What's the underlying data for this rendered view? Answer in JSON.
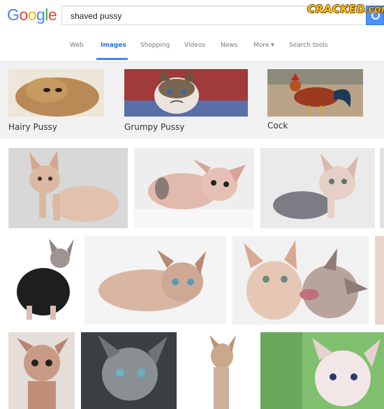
{
  "search": {
    "query": "shaved pussy"
  },
  "logo": {
    "letters": [
      "G",
      "o",
      "o",
      "g",
      "l",
      "e"
    ],
    "colors": [
      "#4285f4",
      "#ea4335",
      "#fbbc05",
      "#4285f4",
      "#34a853",
      "#ea4335"
    ]
  },
  "watermark": {
    "text": "CRACKED",
    "suffix": ".COM"
  },
  "nav": {
    "tabs": [
      {
        "label": "Web"
      },
      {
        "label": "Images"
      },
      {
        "label": "Shopping"
      },
      {
        "label": "Videos"
      },
      {
        "label": "News"
      },
      {
        "label": "More ▾"
      },
      {
        "label": "Search tools"
      }
    ],
    "active": "Images"
  },
  "related": [
    {
      "label": "Hairy Pussy"
    },
    {
      "label": "Grumpy Pussy"
    },
    {
      "label": "Cock"
    }
  ],
  "colors": {
    "accent": "#4285f4",
    "search_button": "#4d90fe"
  }
}
